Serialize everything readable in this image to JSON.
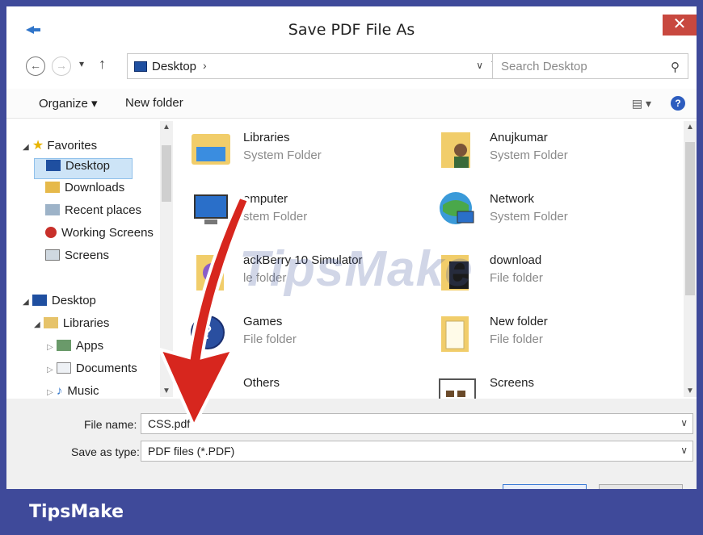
{
  "window": {
    "title": "Save PDF File As",
    "close_glyph": "✕"
  },
  "address": {
    "location": "Desktop",
    "search_placeholder": "Search Desktop"
  },
  "toolbar": {
    "organize": "Organize ▾",
    "new_folder": "New folder"
  },
  "nav": {
    "favorites": "Favorites",
    "items": [
      "Desktop",
      "Downloads",
      "Recent places",
      "Working Screens",
      "Screens"
    ],
    "tree_desktop": "Desktop",
    "libraries": "Libraries",
    "lib_items": [
      "Apps",
      "Documents",
      "Music"
    ]
  },
  "content": {
    "tiles": [
      {
        "name": "Libraries",
        "type": "System Folder"
      },
      {
        "name": "Anujkumar",
        "type": "System Folder"
      },
      {
        "name": "omputer",
        "type": "stem Folder"
      },
      {
        "name": "Network",
        "type": "System Folder"
      },
      {
        "name": "ackBerry 10 Simulator",
        "type": "le folder"
      },
      {
        "name": "download",
        "type": "File folder"
      },
      {
        "name": "Games",
        "type": "File folder"
      },
      {
        "name": "New folder",
        "type": "File folder"
      },
      {
        "name": "Others",
        "type": ""
      },
      {
        "name": "Screens",
        "type": ""
      }
    ]
  },
  "save": {
    "file_name_label": "File name:",
    "file_name_value": "CSS.pdf",
    "type_label": "Save as type:",
    "type_value": "PDF files (*.PDF)"
  },
  "watermark": "TipsMake",
  "banner": {
    "brand": "TipsMake"
  },
  "colors": {
    "accent": "#3f4a9a",
    "close": "#c8483f",
    "selection": "#cde4f7",
    "arrow": "#d7261e"
  }
}
